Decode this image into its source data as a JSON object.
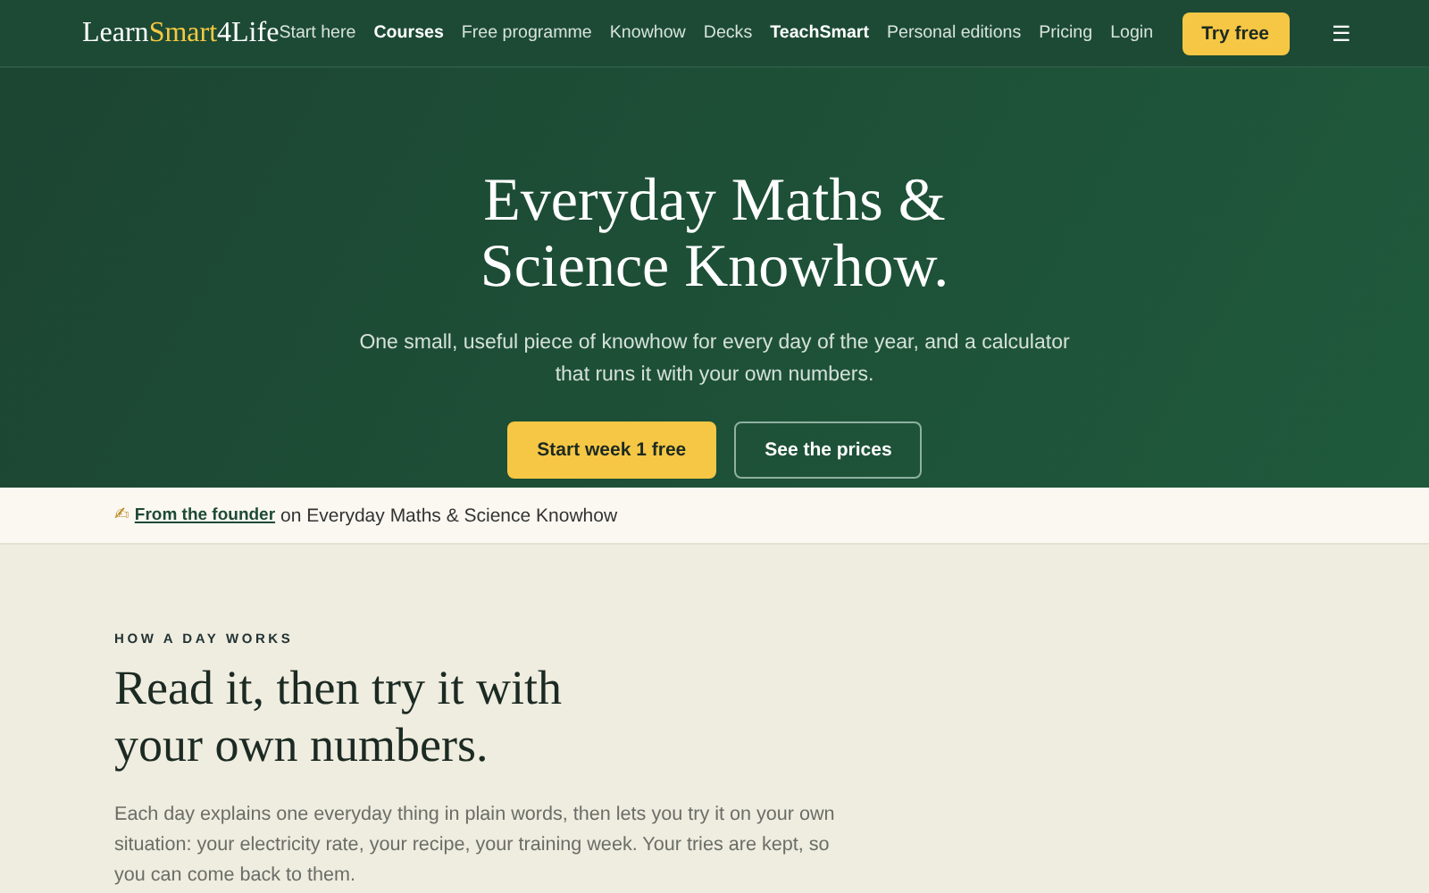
{
  "header": {
    "logo": [
      {
        "text": "Learn",
        "accent": false
      },
      {
        "text": "Smart",
        "accent": true
      },
      {
        "text": "4Life",
        "accent": false
      }
    ],
    "nav": [
      {
        "label": "Start here",
        "kind": "plain"
      },
      {
        "label": "Courses",
        "kind": "strong"
      },
      {
        "label": "Free programme",
        "kind": "plain"
      },
      {
        "label": "Knowhow",
        "kind": "plain"
      },
      {
        "label": "Decks",
        "kind": "plain"
      },
      {
        "label": "TeachSmart",
        "kind": "strong"
      },
      {
        "label": "Personal editions",
        "kind": "plain"
      },
      {
        "label": "Pricing",
        "kind": "plain"
      },
      {
        "label": "Login",
        "kind": "plain"
      }
    ],
    "cta": "Try free",
    "menu": "☰"
  },
  "hero": {
    "title_lines": [
      "Everyday Maths &",
      "Science Knowhow."
    ],
    "subtitle": "One small, useful piece of knowhow for every day of the year, and a calculator that runs it with your own numbers.",
    "buttons": [
      {
        "label": "Start week 1 free",
        "kind": "primary"
      },
      {
        "label": "See the prices",
        "kind": "outline"
      }
    ]
  },
  "founder": {
    "icon": "✍",
    "link": "From the founder",
    "text": "on Everyday Maths & Science Knowhow"
  },
  "section": {
    "eyebrow": "HOW A DAY WORKS",
    "title_lines": [
      "Read it, then try it with",
      "your own numbers."
    ],
    "body": "Each day explains one everyday thing in plain words, then lets you try it on your own situation: your electricity rate, your recipe, your training week. Your tries are kept, so you can come back to them."
  }
}
